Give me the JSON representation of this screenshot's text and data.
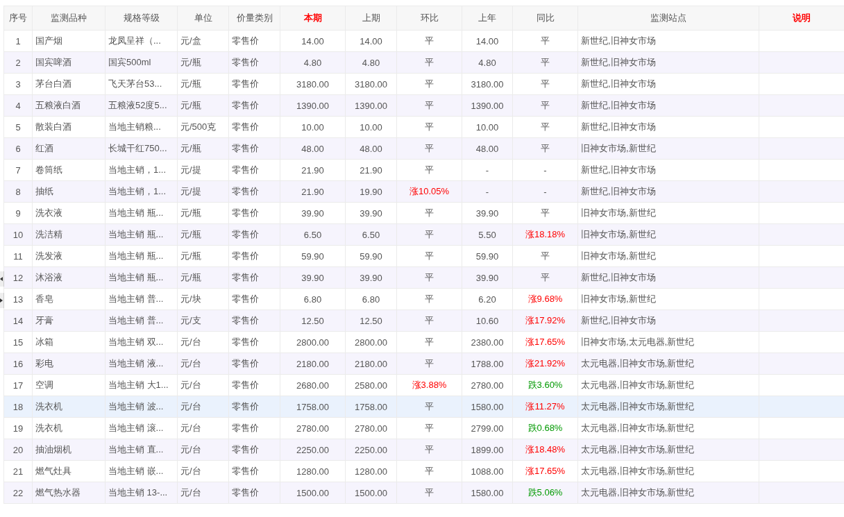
{
  "table": {
    "columns": [
      {
        "label": "序号",
        "highlight": false
      },
      {
        "label": "监测品种",
        "highlight": false
      },
      {
        "label": "规格等级",
        "highlight": false
      },
      {
        "label": "单位",
        "highlight": false
      },
      {
        "label": "价量类别",
        "highlight": false
      },
      {
        "label": "本期",
        "highlight": true
      },
      {
        "label": "上期",
        "highlight": false
      },
      {
        "label": "环比",
        "highlight": false
      },
      {
        "label": "上年",
        "highlight": false
      },
      {
        "label": "同比",
        "highlight": false
      },
      {
        "label": "监测站点",
        "highlight": false
      },
      {
        "label": "说明",
        "highlight": true
      }
    ],
    "rows": [
      {
        "no": "1",
        "item": "国产烟",
        "spec": "龙凤呈祥（...",
        "unit": "元/盒",
        "type": "零售价",
        "current": "14.00",
        "previous": "14.00",
        "mom": {
          "text": "平"
        },
        "last_year": "14.00",
        "yoy": {
          "text": "平"
        },
        "stations": "新世纪,旧神女市场",
        "selected": false
      },
      {
        "no": "2",
        "item": "国宾啤酒",
        "spec": "国宾500ml",
        "unit": "元/瓶",
        "type": "零售价",
        "current": "4.80",
        "previous": "4.80",
        "mom": {
          "text": "平"
        },
        "last_year": "4.80",
        "yoy": {
          "text": "平"
        },
        "stations": "新世纪,旧神女市场",
        "selected": false
      },
      {
        "no": "3",
        "item": "茅台白酒",
        "spec": "飞天茅台53...",
        "unit": "元/瓶",
        "type": "零售价",
        "current": "3180.00",
        "previous": "3180.00",
        "mom": {
          "text": "平"
        },
        "last_year": "3180.00",
        "yoy": {
          "text": "平"
        },
        "stations": "新世纪,旧神女市场",
        "selected": false
      },
      {
        "no": "4",
        "item": "五粮液白酒",
        "spec": "五粮液52度5...",
        "unit": "元/瓶",
        "type": "零售价",
        "current": "1390.00",
        "previous": "1390.00",
        "mom": {
          "text": "平"
        },
        "last_year": "1390.00",
        "yoy": {
          "text": "平"
        },
        "stations": "新世纪,旧神女市场",
        "selected": false
      },
      {
        "no": "5",
        "item": "散装白酒",
        "spec": "当地主销粮...",
        "unit": "元/500克",
        "type": "零售价",
        "current": "10.00",
        "previous": "10.00",
        "mom": {
          "text": "平"
        },
        "last_year": "10.00",
        "yoy": {
          "text": "平"
        },
        "stations": "新世纪,旧神女市场",
        "selected": false
      },
      {
        "no": "6",
        "item": "红酒",
        "spec": "长城干红750...",
        "unit": "元/瓶",
        "type": "零售价",
        "current": "48.00",
        "previous": "48.00",
        "mom": {
          "text": "平"
        },
        "last_year": "48.00",
        "yoy": {
          "text": "平"
        },
        "stations": "旧神女市场,新世纪",
        "selected": false
      },
      {
        "no": "7",
        "item": "卷筒纸",
        "spec": "当地主销，1...",
        "unit": "元/提",
        "type": "零售价",
        "current": "21.90",
        "previous": "21.90",
        "mom": {
          "text": "平"
        },
        "last_year": "-",
        "yoy": {
          "text": "-"
        },
        "stations": "新世纪,旧神女市场",
        "selected": false
      },
      {
        "no": "8",
        "item": "抽纸",
        "spec": "当地主销，1...",
        "unit": "元/提",
        "type": "零售价",
        "current": "21.90",
        "previous": "19.90",
        "mom": {
          "text": "涨10.05%",
          "color": "#ff0000"
        },
        "last_year": "-",
        "yoy": {
          "text": "-"
        },
        "stations": "新世纪,旧神女市场",
        "selected": false
      },
      {
        "no": "9",
        "item": "洗衣液",
        "spec": "当地主销 瓶...",
        "unit": "元/瓶",
        "type": "零售价",
        "current": "39.90",
        "previous": "39.90",
        "mom": {
          "text": "平"
        },
        "last_year": "39.90",
        "yoy": {
          "text": "平"
        },
        "stations": "旧神女市场,新世纪",
        "selected": false
      },
      {
        "no": "10",
        "item": "洗洁精",
        "spec": "当地主销 瓶...",
        "unit": "元/瓶",
        "type": "零售价",
        "current": "6.50",
        "previous": "6.50",
        "mom": {
          "text": "平"
        },
        "last_year": "5.50",
        "yoy": {
          "text": "涨18.18%",
          "color": "#ff0000"
        },
        "stations": "旧神女市场,新世纪",
        "selected": false
      },
      {
        "no": "11",
        "item": "洗发液",
        "spec": "当地主销 瓶...",
        "unit": "元/瓶",
        "type": "零售价",
        "current": "59.90",
        "previous": "59.90",
        "mom": {
          "text": "平"
        },
        "last_year": "59.90",
        "yoy": {
          "text": "平"
        },
        "stations": "旧神女市场,新世纪",
        "selected": false
      },
      {
        "no": "12",
        "item": "沐浴液",
        "spec": "当地主销 瓶...",
        "unit": "元/瓶",
        "type": "零售价",
        "current": "39.90",
        "previous": "39.90",
        "mom": {
          "text": "平"
        },
        "last_year": "39.90",
        "yoy": {
          "text": "平"
        },
        "stations": "新世纪,旧神女市场",
        "selected": false
      },
      {
        "no": "13",
        "item": "香皂",
        "spec": "当地主销 普...",
        "unit": "元/块",
        "type": "零售价",
        "current": "6.80",
        "previous": "6.80",
        "mom": {
          "text": "平"
        },
        "last_year": "6.20",
        "yoy": {
          "text": "涨9.68%",
          "color": "#ff0000"
        },
        "stations": "旧神女市场,新世纪",
        "selected": false
      },
      {
        "no": "14",
        "item": "牙膏",
        "spec": "当地主销 普...",
        "unit": "元/支",
        "type": "零售价",
        "current": "12.50",
        "previous": "12.50",
        "mom": {
          "text": "平"
        },
        "last_year": "10.60",
        "yoy": {
          "text": "涨17.92%",
          "color": "#ff0000"
        },
        "stations": "新世纪,旧神女市场",
        "selected": false
      },
      {
        "no": "15",
        "item": "冰箱",
        "spec": "当地主销 双...",
        "unit": "元/台",
        "type": "零售价",
        "current": "2800.00",
        "previous": "2800.00",
        "mom": {
          "text": "平"
        },
        "last_year": "2380.00",
        "yoy": {
          "text": "涨17.65%",
          "color": "#ff0000"
        },
        "stations": "旧神女市场,太元电器,新世纪",
        "selected": false
      },
      {
        "no": "16",
        "item": "彩电",
        "spec": "当地主销 液...",
        "unit": "元/台",
        "type": "零售价",
        "current": "2180.00",
        "previous": "2180.00",
        "mom": {
          "text": "平"
        },
        "last_year": "1788.00",
        "yoy": {
          "text": "涨21.92%",
          "color": "#ff0000"
        },
        "stations": "太元电器,旧神女市场,新世纪",
        "selected": false
      },
      {
        "no": "17",
        "item": "空调",
        "spec": "当地主销 大1...",
        "unit": "元/台",
        "type": "零售价",
        "current": "2680.00",
        "previous": "2580.00",
        "mom": {
          "text": "涨3.88%",
          "color": "#ff0000"
        },
        "last_year": "2780.00",
        "yoy": {
          "text": "跌3.60%",
          "color": "#009900"
        },
        "stations": "太元电器,旧神女市场,新世纪",
        "selected": false
      },
      {
        "no": "18",
        "item": "洗衣机",
        "spec": "当地主销 波...",
        "unit": "元/台",
        "type": "零售价",
        "current": "1758.00",
        "previous": "1758.00",
        "mom": {
          "text": "平"
        },
        "last_year": "1580.00",
        "yoy": {
          "text": "涨11.27%",
          "color": "#ff0000"
        },
        "stations": "太元电器,旧神女市场,新世纪",
        "selected": true
      },
      {
        "no": "19",
        "item": "洗衣机",
        "spec": "当地主销 滚...",
        "unit": "元/台",
        "type": "零售价",
        "current": "2780.00",
        "previous": "2780.00",
        "mom": {
          "text": "平"
        },
        "last_year": "2799.00",
        "yoy": {
          "text": "跌0.68%",
          "color": "#009900"
        },
        "stations": "太元电器,旧神女市场,新世纪",
        "selected": false
      },
      {
        "no": "20",
        "item": "抽油烟机",
        "spec": "当地主销 直...",
        "unit": "元/台",
        "type": "零售价",
        "current": "2250.00",
        "previous": "2250.00",
        "mom": {
          "text": "平"
        },
        "last_year": "1899.00",
        "yoy": {
          "text": "涨18.48%",
          "color": "#ff0000"
        },
        "stations": "太元电器,旧神女市场,新世纪",
        "selected": false
      },
      {
        "no": "21",
        "item": "燃气灶具",
        "spec": "当地主销 嵌...",
        "unit": "元/台",
        "type": "零售价",
        "current": "1280.00",
        "previous": "1280.00",
        "mom": {
          "text": "平"
        },
        "last_year": "1088.00",
        "yoy": {
          "text": "涨17.65%",
          "color": "#ff0000"
        },
        "stations": "太元电器,旧神女市场,新世纪",
        "selected": false
      },
      {
        "no": "22",
        "item": "燃气热水器",
        "spec": "当地主销 13-...",
        "unit": "元/台",
        "type": "零售价",
        "current": "1500.00",
        "previous": "1500.00",
        "mom": {
          "text": "平"
        },
        "last_year": "1580.00",
        "yoy": {
          "text": "跌5.06%",
          "color": "#009900"
        },
        "stations": "太元电器,旧神女市场,新世纪",
        "selected": false
      }
    ]
  }
}
